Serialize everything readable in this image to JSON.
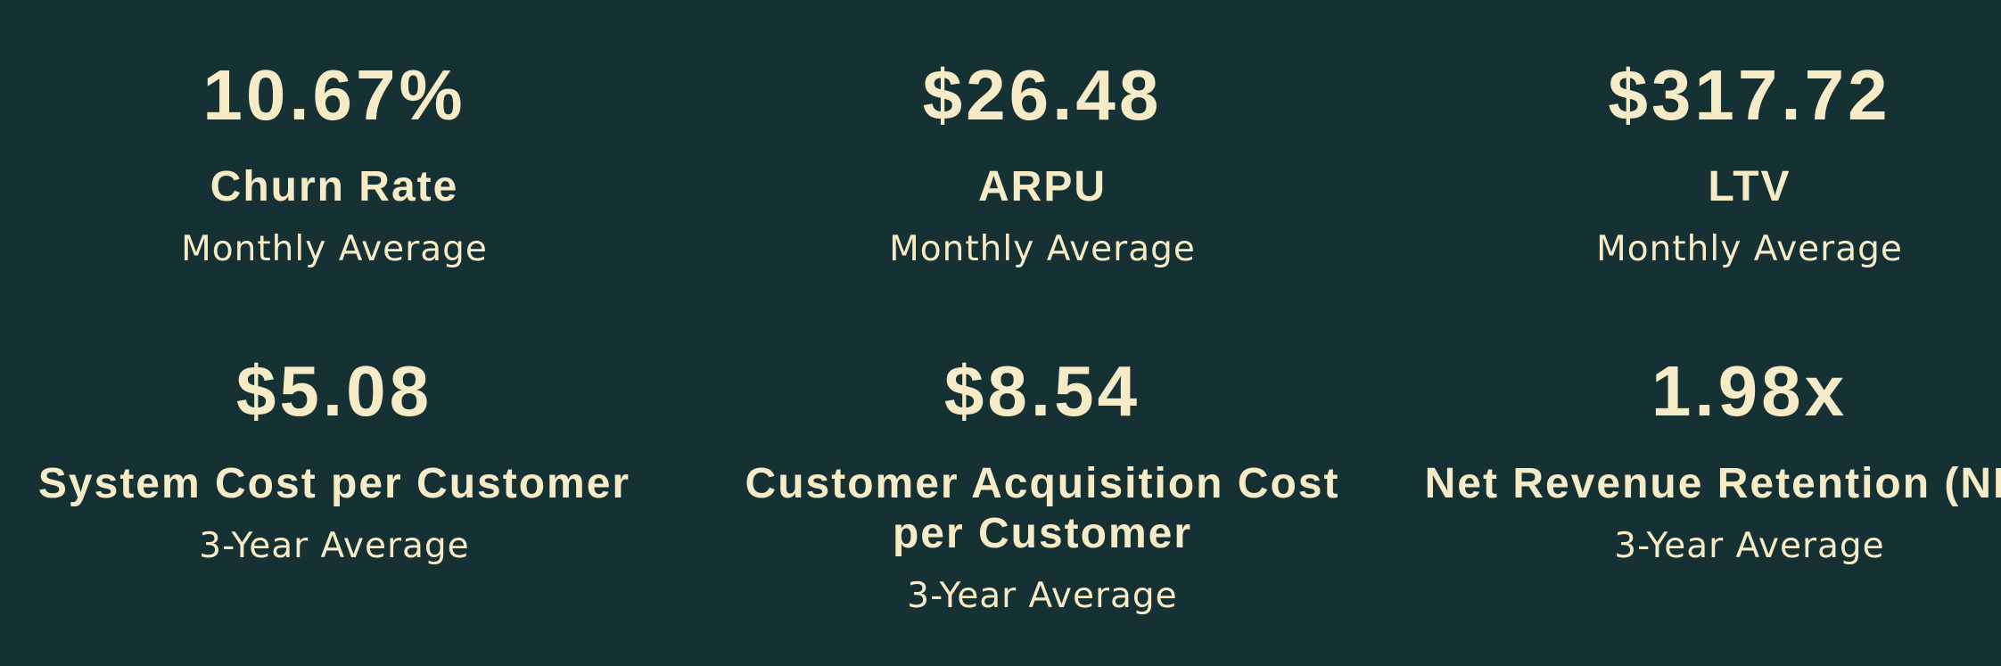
{
  "colors": {
    "background": "#153133",
    "text": "#f5ebc6"
  },
  "metrics": [
    {
      "value": "10.67%",
      "label": "Churn Rate",
      "subtitle": "Monthly Average"
    },
    {
      "value": "$26.48",
      "label": "ARPU",
      "subtitle": "Monthly Average"
    },
    {
      "value": "$317.72",
      "label": "LTV",
      "subtitle": "Monthly Average"
    },
    {
      "value": "$5.08",
      "label": "System Cost per Customer",
      "subtitle": "3-Year Average"
    },
    {
      "value": "$8.54",
      "label": "Customer Acquisition Cost per Customer",
      "subtitle": "3-Year Average"
    },
    {
      "value": "1.98x",
      "label": "Net Revenue Retention (NRR)",
      "subtitle": "3-Year Average"
    }
  ]
}
